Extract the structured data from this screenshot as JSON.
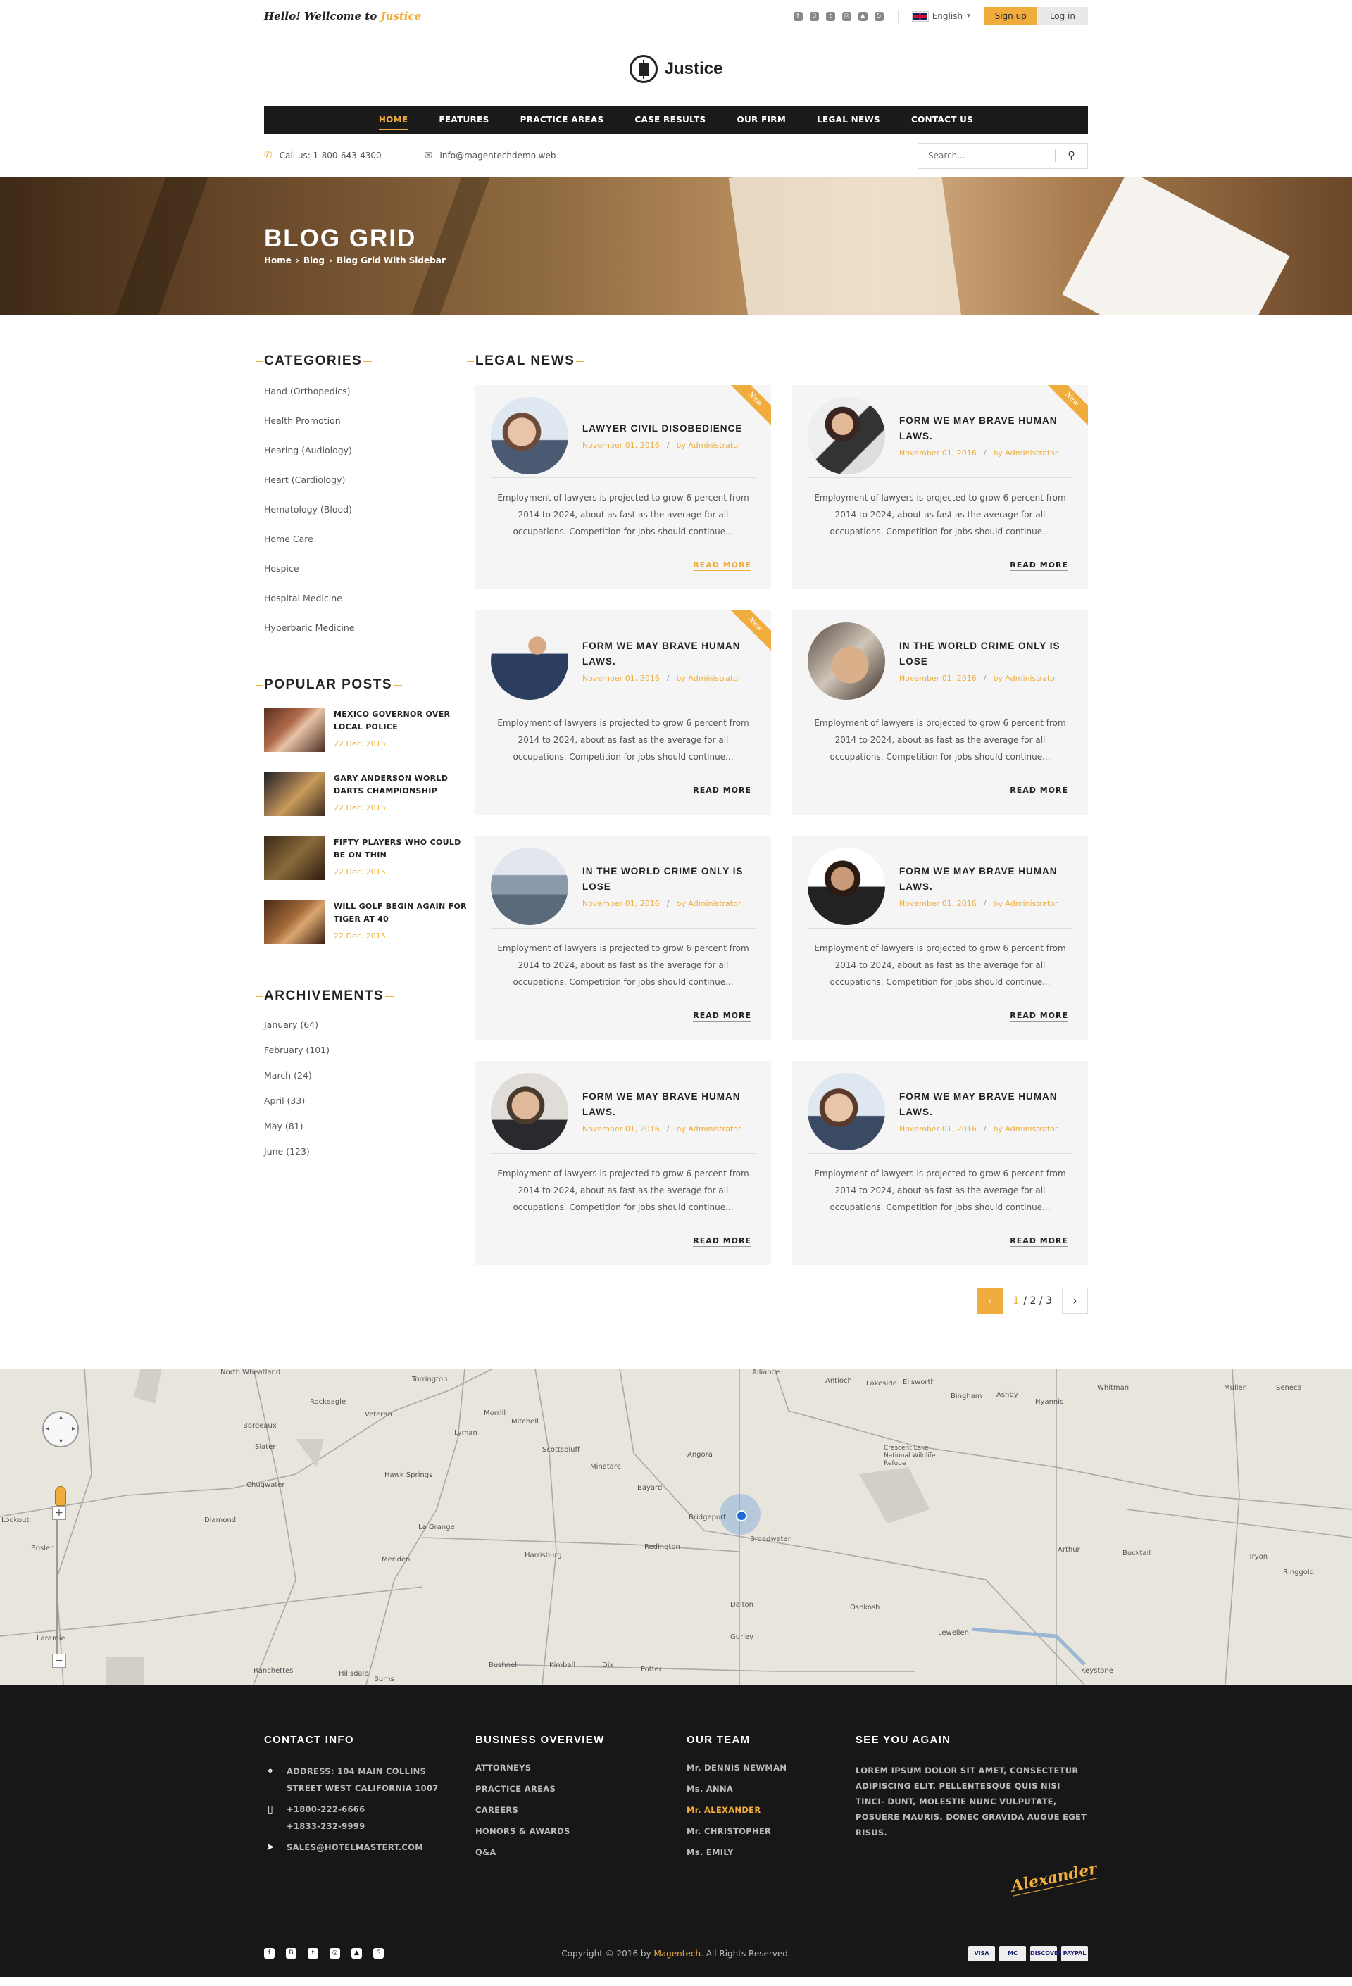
{
  "topbar": {
    "welcome_prefix": "Hello! Wellcome to",
    "welcome_brand": "Justice",
    "socials": [
      "facebook-icon",
      "blogger-icon",
      "twitter-icon",
      "dribbble-icon",
      "google-drive-icon",
      "skype-icon"
    ],
    "language": "English",
    "signup_label": "Sign up",
    "login_label": "Log in"
  },
  "header": {
    "logo_text": "Justice",
    "nav": [
      {
        "label": "HOME",
        "active": true
      },
      {
        "label": "FEATURES"
      },
      {
        "label": "PRACTICE AREAS"
      },
      {
        "label": "CASE RESULTS"
      },
      {
        "label": "OUR FIRM"
      },
      {
        "label": "LEGAL NEWS"
      },
      {
        "label": "CONTACT US"
      }
    ],
    "phone": "Call us: 1-800-643-4300",
    "email": "Info@magentechdemo.web",
    "search_placeholder": "Search..."
  },
  "hero": {
    "title": "BLOG GRID",
    "breadcrumbs": [
      "Home",
      "Blog",
      "Blog Grid With Sidebar"
    ]
  },
  "sidebar": {
    "categories_title": "CATEGORIES",
    "categories": [
      "Hand (Orthopedics)",
      "Health Promotion",
      "Hearing (Audiology)",
      "Heart (Cardiology)",
      "Hematology (Blood)",
      "Home Care",
      "Hospice",
      "Hospital Medicine",
      "Hyperbaric Medicine"
    ],
    "popular_title": "POPULAR POSTS",
    "popular": [
      {
        "title": "MEXICO GOVERNOR OVER LOCAL POLICE",
        "date": "22 Dec. 2015"
      },
      {
        "title": "GARY ANDERSON WORLD DARTS CHAMPIONSHIP",
        "date": "22 Dec. 2015"
      },
      {
        "title": "FIFTY PLAYERS WHO COULD BE ON THIN",
        "date": "22 Dec. 2015"
      },
      {
        "title": "WILL GOLF BEGIN AGAIN FOR TIGER AT 40",
        "date": "22 Dec. 2015"
      }
    ],
    "archive_title": "ARCHIVEMENTS",
    "archives": [
      "January (64)",
      "February (101)",
      "March (24)",
      "April (33)",
      "May (81)",
      "June (123)"
    ]
  },
  "content": {
    "title": "LEGAL NEWS",
    "new_badge": "New",
    "posts": [
      {
        "title": "LAWYER CIVIL DISOBEDIENCE",
        "date": "November 01, 2016",
        "author": "by Administrator",
        "excerpt": "Employment of lawyers is projected to grow 6 percent from 2014 to 2024, about as fast as the average for all occupations. Competition for jobs should continue...",
        "read_more": "READ MORE",
        "is_new": true,
        "highlight": true
      },
      {
        "title": "FORM WE MAY BRAVE HUMAN LAWS.",
        "date": "November 01, 2016",
        "author": "by Administrator",
        "excerpt": "Employment of lawyers is projected to grow 6 percent from 2014 to 2024, about as fast as the average for all occupations. Competition for jobs should continue...",
        "read_more": "READ MORE",
        "is_new": true
      },
      {
        "title": "FORM WE MAY BRAVE HUMAN LAWS.",
        "date": "November 01, 2016",
        "author": "by Administrator",
        "excerpt": "Employment of lawyers is projected to grow 6 percent from 2014 to 2024, about as fast as the average for all occupations. Competition for jobs should continue...",
        "read_more": "READ MORE",
        "is_new": true
      },
      {
        "title": "IN THE WORLD CRIME ONLY IS LOSE",
        "date": "November 01, 2016",
        "author": "by Administrator",
        "excerpt": "Employment of lawyers is projected to grow 6 percent from 2014 to 2024, about as fast as the average for all occupations. Competition for jobs should continue...",
        "read_more": "READ MORE"
      },
      {
        "title": "IN THE WORLD CRIME ONLY IS LOSE",
        "date": "November 01, 2016",
        "author": "by Administrator",
        "excerpt": "Employment of lawyers is projected to grow 6 percent from 2014 to 2024, about as fast as the average for all occupations. Competition for jobs should continue...",
        "read_more": "READ MORE"
      },
      {
        "title": "FORM WE MAY BRAVE HUMAN LAWS.",
        "date": "November 01, 2016",
        "author": "by Administrator",
        "excerpt": "Employment of lawyers is projected to grow 6 percent from 2014 to 2024, about as fast as the average for all occupations. Competition for jobs should continue...",
        "read_more": "READ MORE"
      },
      {
        "title": "FORM WE MAY BRAVE HUMAN LAWS.",
        "date": "November 01, 2016",
        "author": "by Administrator",
        "excerpt": "Employment of lawyers is projected to grow 6 percent from 2014 to 2024, about as fast as the average for all occupations. Competition for jobs should continue...",
        "read_more": "READ MORE"
      },
      {
        "title": "FORM WE MAY BRAVE HUMAN LAWS.",
        "date": "November 01, 2016",
        "author": "by Administrator",
        "excerpt": "Employment of lawyers is projected to grow 6 percent from 2014 to 2024, about as fast as the average for all occupations. Competition for jobs should continue...",
        "read_more": "READ MORE"
      }
    ],
    "pagination": {
      "current": "1",
      "rest": "/ 2 / 3"
    }
  },
  "map": {
    "labels": [
      "North Wheatland",
      "Rockeagle",
      "Torrington",
      "Veteran",
      "Morrill",
      "Mitchell",
      "Lyman",
      "Scottsbluff",
      "Minatare",
      "Bayard",
      "Angora",
      "Alliance",
      "Antioch",
      "Lakeside",
      "Ellsworth",
      "Bingham",
      "Ashby",
      "Hyannis",
      "Whitman",
      "Mullen",
      "Seneca",
      "Bordeaux",
      "Slater",
      "Chugwater",
      "Hawk Springs",
      "Diamond",
      "La Grange",
      "Meriden",
      "Harrisburg",
      "Redington",
      "Bridgeport",
      "Broadwater",
      "Crescent Lake National Wildlife Refuge",
      "Arthur",
      "Tryon",
      "Ringgold",
      "Bucktail",
      "Dalton",
      "Oshkosh",
      "Lewellen",
      "Keystone",
      "Gurley",
      "Laramie",
      "Ranchettes",
      "Hillsdale",
      "Burns",
      "Bushnell",
      "Kimball",
      "Dix",
      "Potter",
      "Lookout",
      "Bosler"
    ]
  },
  "footer": {
    "contact_title": "CONTACT INFO",
    "address_line1": "ADDRESS: 104 MAIN COLLINS",
    "address_line2": "STREET WEST CALIFORNIA 1007",
    "phone1": "+1800-222-6666",
    "phone2": "+1833-232-9999",
    "email": "SALES@HOTELMASTERT.COM",
    "business_title": "BUSINESS OVERVIEW",
    "business_links": [
      "ATTORNEYS",
      "PRACTICE AREAS",
      "CAREERS",
      "HONORS & AWARDS",
      "Q&A"
    ],
    "team_title": "OUR TEAM",
    "team": [
      {
        "name": "Mr. DENNIS NEWMAN"
      },
      {
        "name": "Ms. ANNA"
      },
      {
        "name": "Mr. ALEXANDER",
        "highlight": true
      },
      {
        "name": "Mr. CHRISTOPHER"
      },
      {
        "name": "Ms. EMILY"
      }
    ],
    "see_title": "SEE YOU AGAIN",
    "see_text": "LOREM IPSUM DOLOR SIT AMET, CONSECTETUR ADIPISCING ELIT. PELLENTESQUE QUIS NISI TINCI- DUNT, MOLESTIE NUNC VULPUTATE, POSUERE MAURIS. DONEC GRAVIDA AUGUE EGET RISUS.",
    "signature": "Alexander",
    "copyright_prefix": "Copyright © 2016 by",
    "copyright_brand": "Magentech",
    "copyright_suffix": ". All Rights Reserved.",
    "payments": [
      "VISA",
      "MC",
      "DISCOVER",
      "PAYPAL"
    ]
  },
  "colors": {
    "accent": "#f0ad3d",
    "dark": "#1b1b1b",
    "footer_bg": "#171717",
    "card_bg": "#f5f5f5"
  }
}
